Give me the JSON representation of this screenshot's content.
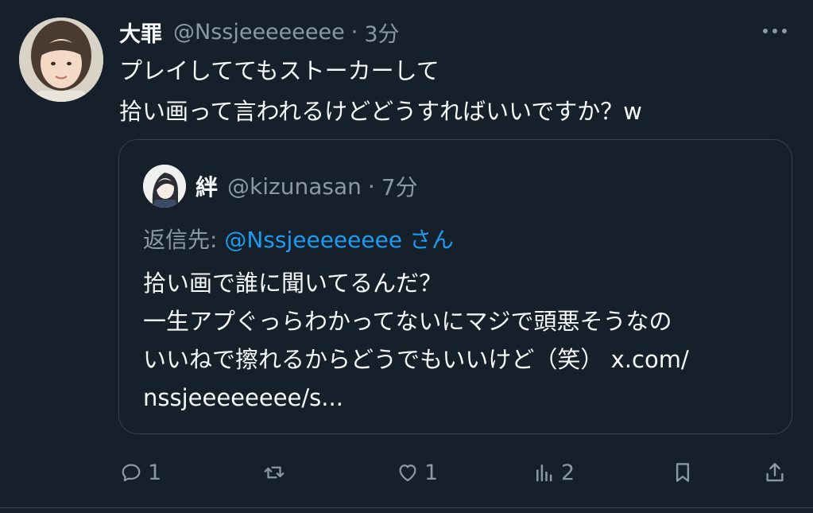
{
  "tweet": {
    "author": {
      "display_name": "大罪",
      "handle": "@Nssjeeeeeeee",
      "time": "3分"
    },
    "separator": "·",
    "text": "プレイしててもストーカーして\n拾い画って言われるけどどうすればいいですか？w"
  },
  "quote": {
    "author": {
      "display_name": "絆",
      "handle": "@kizunasan",
      "time": "7分"
    },
    "separator": "·",
    "reply_prefix": "返信先: ",
    "reply_mention": "@Nssjeeeeeeee",
    "reply_suffix": " さん",
    "text": "拾い画で誰に聞いてるんだ？\n一生アプぐっらわかってないにマジで頭悪そうなの\nいいねで擦れるからどうでもいいけど（笑） x.com/\nnssjeeeeeeee/s..."
  },
  "actions": {
    "reply_count": "1",
    "retweet_count": "",
    "like_count": "1",
    "views_count": "2"
  },
  "icons": {
    "more": "more-horizontal-icon",
    "reply": "reply-icon",
    "retweet": "retweet-icon",
    "like": "heart-icon",
    "views": "views-icon",
    "bookmark": "bookmark-icon",
    "share": "share-icon"
  },
  "colors": {
    "background": "#15202b",
    "text": "#f7f9f9",
    "muted": "#8b98a5",
    "accent": "#1d9bf0",
    "border": "#38444d"
  }
}
